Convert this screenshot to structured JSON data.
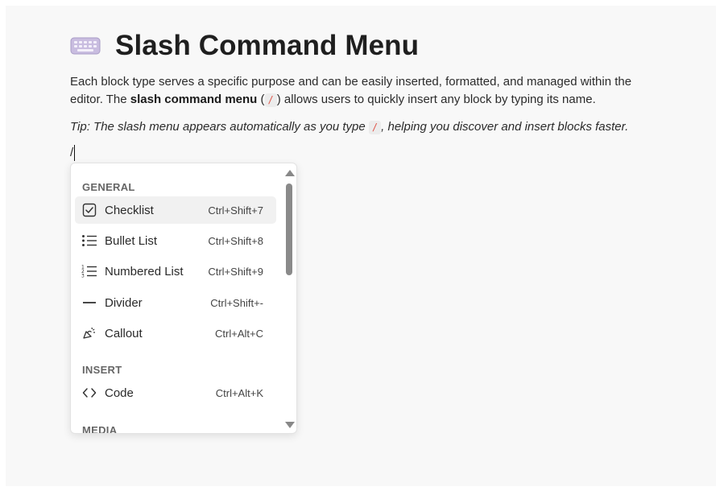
{
  "page": {
    "title_emoji": "keyboard-emoji",
    "title": "Slash Command Menu",
    "paragraph": {
      "part1": "Each block type serves a specific purpose and can be easily inserted, formatted, and managed within the editor. The ",
      "bold": "slash command menu",
      "part2": " (",
      "code": "/",
      "part3": ") allows users to quickly insert any block by typing its name."
    },
    "tip": {
      "part1": "Tip: The slash menu appears automatically as you type ",
      "code": "/",
      "part2": ", helping you discover and insert blocks faster."
    },
    "editor_text": "/"
  },
  "menu": {
    "sections": [
      {
        "label": "GENERAL"
      },
      {
        "label": "INSERT"
      },
      {
        "label": "MEDIA"
      }
    ],
    "items": [
      {
        "label": "Checklist",
        "shortcut": "Ctrl+Shift+7",
        "icon": "checkbox-icon",
        "active": true
      },
      {
        "label": "Bullet List",
        "shortcut": "Ctrl+Shift+8",
        "icon": "bullet-list-icon"
      },
      {
        "label": "Numbered List",
        "shortcut": "Ctrl+Shift+9",
        "icon": "numbered-list-icon"
      },
      {
        "label": "Divider",
        "shortcut": "Ctrl+Shift+-",
        "icon": "divider-icon"
      },
      {
        "label": "Callout",
        "shortcut": "Ctrl+Alt+C",
        "icon": "callout-icon"
      },
      {
        "label": "Code",
        "shortcut": "Ctrl+Alt+K",
        "icon": "code-icon"
      }
    ]
  }
}
